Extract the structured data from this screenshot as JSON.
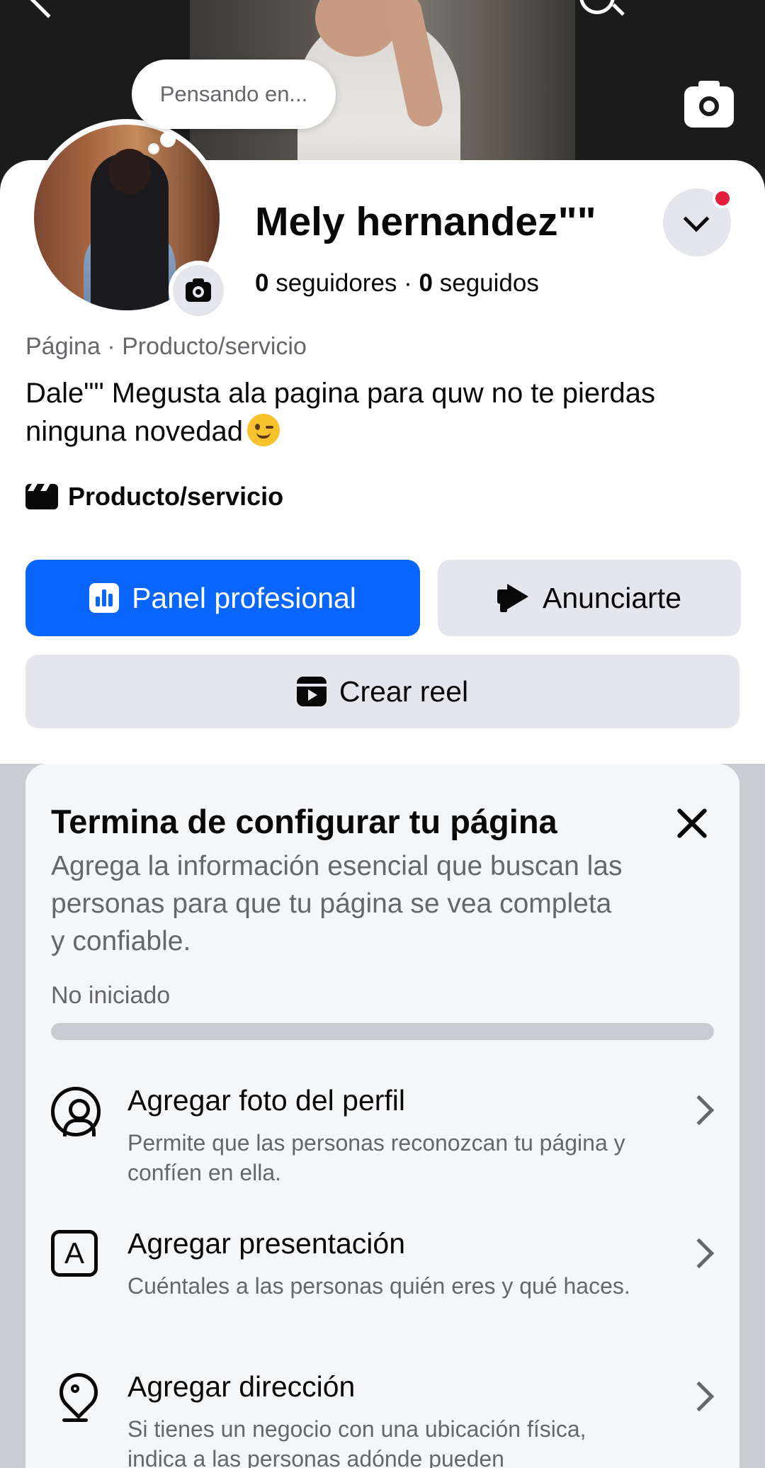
{
  "bubble": {
    "text": "Pensando en..."
  },
  "profile": {
    "name": "Mely hernandez\"\"",
    "followers_count": "0",
    "followers_label": " seguidores · ",
    "following_count": "0",
    "following_label": " seguidos",
    "category_line": "Página · Producto/servicio",
    "bio": "Dale\"\" Megusta ala pagina para quw no te pierdas ninguna novedad",
    "category": "Producto/servicio"
  },
  "actions": {
    "professional_panel": "Panel profesional",
    "advertise": "Anunciarte",
    "create_reel": "Crear reel"
  },
  "setup_card": {
    "title": "Termina de configurar tu página",
    "description": "Agrega la información esencial que buscan las personas para que tu página se vea completa y confiable.",
    "status": "No iniciado",
    "progress": 0,
    "tasks": [
      {
        "title": "Agregar foto del perfil",
        "description": "Permite que las personas reconozcan tu página y confíen en ella.",
        "icon": "person-circle-icon"
      },
      {
        "title": "Agregar presentación",
        "description": "Cuéntales a las personas quién eres y qué haces.",
        "icon": "letter-a-icon",
        "icon_letter": "A"
      },
      {
        "title": "Agregar dirección",
        "description": "Si tienes un negocio con una ubicación física, indica a las personas adónde pueden",
        "icon": "location-pin-icon"
      }
    ]
  },
  "colors": {
    "primary": "#0866ff",
    "secondary_button": "#e4e6eb",
    "notification_dot": "#e41e3f",
    "muted_text": "#65676b"
  }
}
